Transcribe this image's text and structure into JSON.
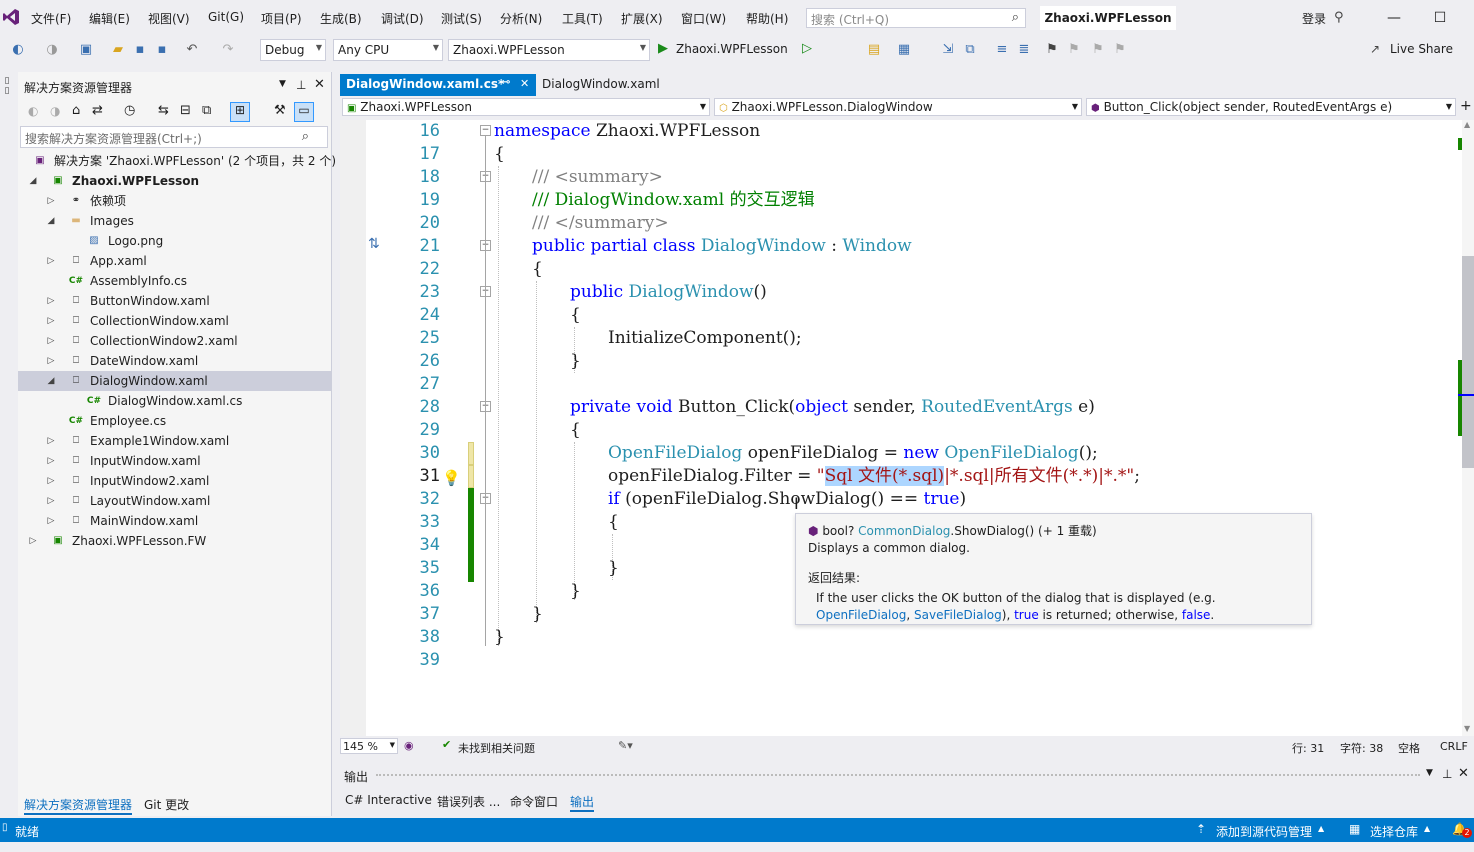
{
  "menubar": {
    "items": [
      "文件(F)",
      "编辑(E)",
      "视图(V)",
      "Git(G)",
      "项目(P)",
      "生成(B)",
      "调试(D)",
      "测试(S)",
      "分析(N)",
      "工具(T)",
      "扩展(X)",
      "窗口(W)",
      "帮助(H)"
    ],
    "search_placeholder": "搜索 (Ctrl+Q)",
    "title": "Zhaoxi.WPFLesson",
    "login": "登录"
  },
  "toolbar": {
    "config": "Debug",
    "platform": "Any CPU",
    "project": "Zhaoxi.WPFLesson",
    "run_label": "Zhaoxi.WPFLesson",
    "live_share": "Live Share"
  },
  "solution_explorer": {
    "title": "解决方案资源管理器",
    "search_placeholder": "搜索解决方案资源管理器(Ctrl+;)",
    "items": [
      {
        "label": "解决方案 'Zhaoxi.WPFLesson' (2 个项目，共 2 个)",
        "icon": "solution-icon"
      },
      {
        "label": "Zhaoxi.WPFLesson",
        "icon": "project-icon",
        "bold": true
      },
      {
        "label": "依赖项",
        "icon": "dependencies-icon"
      },
      {
        "label": "Images",
        "icon": "folder-icon"
      },
      {
        "label": "Logo.png",
        "icon": "image-icon"
      },
      {
        "label": "App.xaml",
        "icon": "xaml-icon"
      },
      {
        "label": "AssemblyInfo.cs",
        "icon": "csharp-icon"
      },
      {
        "label": "ButtonWindow.xaml",
        "icon": "xaml-icon"
      },
      {
        "label": "CollectionWindow.xaml",
        "icon": "xaml-icon"
      },
      {
        "label": "CollectionWindow2.xaml",
        "icon": "xaml-icon"
      },
      {
        "label": "DateWindow.xaml",
        "icon": "xaml-icon"
      },
      {
        "label": "DialogWindow.xaml",
        "icon": "xaml-icon"
      },
      {
        "label": "DialogWindow.xaml.cs",
        "icon": "csharp-icon"
      },
      {
        "label": "Employee.cs",
        "icon": "csharp-icon"
      },
      {
        "label": "Example1Window.xaml",
        "icon": "xaml-icon"
      },
      {
        "label": "InputWindow.xaml",
        "icon": "xaml-icon"
      },
      {
        "label": "InputWindow2.xaml",
        "icon": "xaml-icon"
      },
      {
        "label": "LayoutWindow.xaml",
        "icon": "xaml-icon"
      },
      {
        "label": "MainWindow.xaml",
        "icon": "xaml-icon"
      },
      {
        "label": "Zhaoxi.WPFLesson.FW",
        "icon": "project-icon"
      }
    ],
    "bottom_tabs": [
      "解决方案资源管理器",
      "Git 更改"
    ]
  },
  "editor": {
    "tabs": [
      "DialogWindow.xaml.cs*",
      "DialogWindow.xaml"
    ],
    "nav": [
      "Zhaoxi.WPFLesson",
      "Zhaoxi.WPFLesson.DialogWindow",
      "Button_Click(object sender, RoutedEventArgs e)"
    ],
    "line_numbers": [
      "16",
      "17",
      "18",
      "19",
      "20",
      "21",
      "22",
      "23",
      "24",
      "25",
      "26",
      "27",
      "28",
      "29",
      "30",
      "31",
      "32",
      "33",
      "34",
      "35",
      "36",
      "37",
      "38",
      "39"
    ],
    "code": {
      "l16_kw": "namespace",
      "l16_rest": " Zhaoxi.WPFLesson",
      "l17": "{",
      "l18_a": "/// ",
      "l18_b": "<summary>",
      "l19": "/// DialogWindow.xaml 的交互逻辑",
      "l20_a": "/// ",
      "l20_b": "</summary>",
      "l21_kw": "public partial class ",
      "l21_t": "DialogWindow",
      "l21_c": " : ",
      "l21_t2": "Window",
      "l22": "{",
      "l23_kw": "public ",
      "l23_t": "DialogWindow",
      "l23_rest": "()",
      "l24": "{",
      "l25": "InitializeComponent();",
      "l26": "}",
      "l28_kw": "private void ",
      "l28_m": "Button_Click(",
      "l28_kw2": "object",
      "l28_p": " sender, ",
      "l28_t": "RoutedEventArgs",
      "l28_e": " e)",
      "l29": "{",
      "l30_t": "OpenFileDialog",
      "l30_v": " openFileDialog = ",
      "l30_kw": "new ",
      "l30_t2": "OpenFileDialog",
      "l30_e": "();",
      "l31_a": "openFileDialog.Filter = ",
      "l31_q": "\"",
      "l31_sel": "Sql 文件(*.sql)",
      "l31_rest": "|*.sql|所有文件(*.*)|*.*\"",
      "l31_semi": ";",
      "l32_kw": "if",
      "l32_a": " (openFileDialog.ShowDialog() == ",
      "l32_kw2": "true",
      "l32_e": ")",
      "l33": "{",
      "l35": "}",
      "l36": "}",
      "l37": "}",
      "l38": "}"
    },
    "tooltip": {
      "sig_a": "bool? ",
      "sig_type": "CommonDialog",
      "sig_method": ".ShowDialog() (+ 1 重载)",
      "desc": "Displays a common dialog.",
      "returns_label": "返回结果:",
      "returns_a": "If the user clicks the OK button of the dialog that is displayed (e.g. ",
      "returns_link1": "OpenFileDialog",
      "returns_b": ", ",
      "returns_link2": "SaveFileDialog",
      "returns_c": "), ",
      "returns_true": "true",
      "returns_d": " is returned; otherwise, ",
      "returns_false": "false",
      "returns_e": "."
    },
    "status": {
      "zoom": "145 %",
      "issues": "未找到相关问题",
      "line": "行: 31",
      "col": "字符: 38",
      "spaces": "空格",
      "eol": "CRLF"
    }
  },
  "output": {
    "title": "输出",
    "tabs": [
      "C# Interactive",
      "错误列表 ...",
      "命令窗口",
      "输出"
    ]
  },
  "statusbar": {
    "ready": "就绪",
    "add_source": "添加到源代码管理",
    "select_repo": "选择仓库",
    "notifications": "2"
  },
  "colors": {
    "accent": "#007acc",
    "keyword": "#0000ff",
    "type": "#2b91af",
    "comment": "#008000",
    "string": "#a31515"
  }
}
